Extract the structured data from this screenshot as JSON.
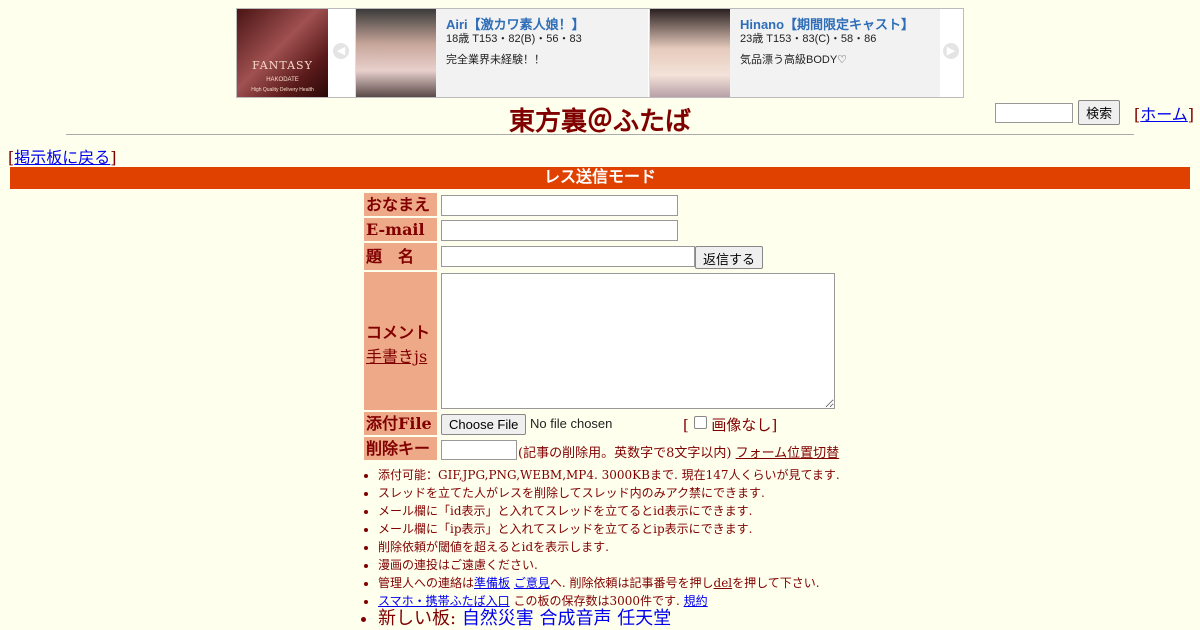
{
  "ad": {
    "logo": {
      "main": "FANTASY",
      "sub": "HAKODATE",
      "tagline": "High Quality Delivery Health"
    },
    "cards": [
      {
        "name": "Airi【激カワ素人娘！】",
        "spec": "18歳 T153・82(B)・56・83",
        "catch": "完全業界未経験！！"
      },
      {
        "name": "Hinano【期間限定キャスト】",
        "spec": "23歳 T153・83(C)・58・86",
        "catch": "気品漂う高級BODY♡"
      }
    ]
  },
  "header": {
    "title": "東方裏＠ふたば",
    "search_button": "検索",
    "home_link": "ホーム",
    "back_link": "掲示板に戻る"
  },
  "mode_bar": "レス送信モード",
  "form": {
    "name_label": "おなまえ",
    "email_label": "E-mail",
    "subject_label": "題　名",
    "submit_label": "返信する",
    "comment_label": "コメント",
    "handwrite_link": "手書きjs",
    "file_label": "添付File",
    "file_button": "Choose File",
    "file_status": "No file chosen",
    "no_image_label": "画像なし",
    "delkey_label": "削除キー",
    "delkey_hint": "(記事の削除用。英数字で8文字以内)",
    "form_toggle_link": "フォーム位置切替"
  },
  "notes": {
    "n1": "添付可能：GIF,JPG,PNG,WEBM,MP4. 3000KBまで. 現在147人くらいが見てます.",
    "n2": "スレッドを立てた人がレスを削除してスレッド内のみアク禁にできます.",
    "n3": "メール欄に「id表示」と入れてスレッドを立てるとid表示にできます.",
    "n4": "メール欄に「ip表示」と入れてスレッドを立てるとip表示にできます.",
    "n5": "削除依頼が閾値を超えるとidを表示します.",
    "n6": "漫画の連投はご遠慮ください.",
    "n7_pre": "管理人への連絡は",
    "n7_link1": "準備板",
    "n7_link2": "ご意見",
    "n7_mid": "へ. 削除依頼は記事番号を押し",
    "n7_link3": "del",
    "n7_post": "を押して下さい.",
    "n8_link": "スマホ・携帯ふたば入口",
    "n8_mid": " この板の保存数は3000件です.",
    "n8_link2": "規約",
    "new_boards_label": "新しい板:",
    "new_boards": [
      "自然災害",
      "合成音声",
      "任天堂"
    ]
  }
}
